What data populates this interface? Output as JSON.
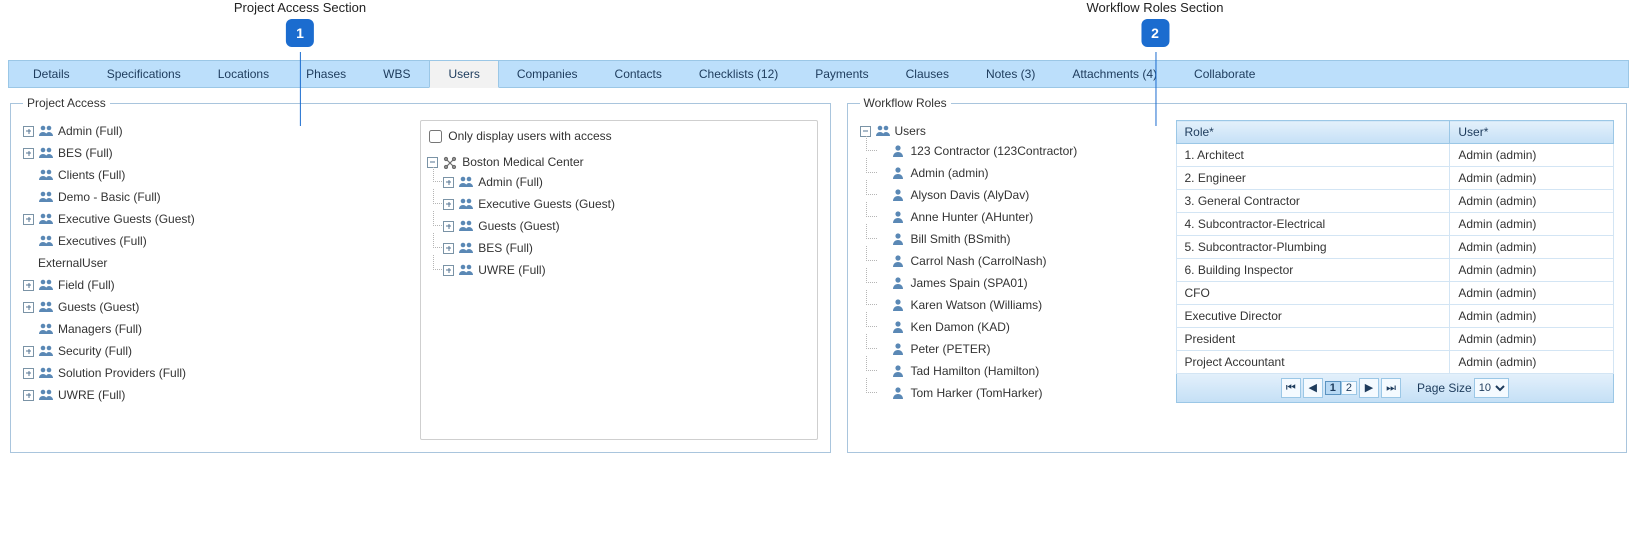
{
  "annotations": {
    "left": {
      "label": "Project Access Section",
      "badge": "1"
    },
    "right": {
      "label": "Workflow Roles Section",
      "badge": "2"
    }
  },
  "tabs": [
    {
      "label": "Details"
    },
    {
      "label": "Specifications"
    },
    {
      "label": "Locations"
    },
    {
      "label": "Phases"
    },
    {
      "label": "WBS"
    },
    {
      "label": "Users",
      "active": true
    },
    {
      "label": "Companies"
    },
    {
      "label": "Contacts"
    },
    {
      "label": "Checklists (12)"
    },
    {
      "label": "Payments"
    },
    {
      "label": "Clauses"
    },
    {
      "label": "Notes (3)"
    },
    {
      "label": "Attachments (4)"
    },
    {
      "label": "Collaborate"
    }
  ],
  "project_access": {
    "legend": "Project Access",
    "only_display_label": "Only display users with access",
    "only_display_checked": false,
    "groups": [
      {
        "label": "Admin (Full)",
        "toggle": "plus",
        "icon": "users"
      },
      {
        "label": "BES (Full)",
        "toggle": "plus",
        "icon": "users"
      },
      {
        "label": "Clients (Full)",
        "toggle": "none",
        "icon": "users"
      },
      {
        "label": "Demo - Basic (Full)",
        "toggle": "none",
        "icon": "users"
      },
      {
        "label": "Executive Guests (Guest)",
        "toggle": "plus",
        "icon": "users"
      },
      {
        "label": "Executives (Full)",
        "toggle": "none",
        "icon": "users"
      },
      {
        "label": "ExternalUser",
        "toggle": "none",
        "icon": "none"
      },
      {
        "label": "Field (Full)",
        "toggle": "plus",
        "icon": "users"
      },
      {
        "label": "Guests (Guest)",
        "toggle": "plus",
        "icon": "users"
      },
      {
        "label": "Managers (Full)",
        "toggle": "none",
        "icon": "users"
      },
      {
        "label": "Security (Full)",
        "toggle": "plus",
        "icon": "users"
      },
      {
        "label": "Solution Providers (Full)",
        "toggle": "plus",
        "icon": "users"
      },
      {
        "label": "UWRE (Full)",
        "toggle": "plus",
        "icon": "users"
      }
    ],
    "org": {
      "label": "Boston Medical Center",
      "toggle": "minus",
      "children": [
        {
          "label": "Admin (Full)",
          "toggle": "plus"
        },
        {
          "label": "Executive Guests (Guest)",
          "toggle": "plus"
        },
        {
          "label": "Guests (Guest)",
          "toggle": "plus"
        },
        {
          "label": "BES (Full)",
          "toggle": "plus"
        },
        {
          "label": "UWRE (Full)",
          "toggle": "plus"
        }
      ]
    }
  },
  "workflow": {
    "legend": "Workflow Roles",
    "users_root": "Users",
    "users": [
      "123 Contractor (123Contractor)",
      "Admin (admin)",
      "Alyson Davis (AlyDav)",
      "Anne Hunter (AHunter)",
      "Bill Smith (BSmith)",
      "Carrol Nash (CarrolNash)",
      "James Spain (SPA01)",
      "Karen Watson (Williams)",
      "Ken Damon (KAD)",
      "Peter (PETER)",
      "Tad Hamilton (Hamilton)",
      "Tom Harker (TomHarker)"
    ],
    "table": {
      "headers": {
        "role": "Role*",
        "user": "User*"
      },
      "rows": [
        {
          "role": "1. Architect",
          "user": "Admin (admin)"
        },
        {
          "role": "2. Engineer",
          "user": "Admin (admin)"
        },
        {
          "role": "3. General Contractor",
          "user": "Admin (admin)"
        },
        {
          "role": "4. Subcontractor-Electrical",
          "user": "Admin (admin)"
        },
        {
          "role": "5. Subcontractor-Plumbing",
          "user": "Admin (admin)"
        },
        {
          "role": "6. Building Inspector",
          "user": "Admin (admin)"
        },
        {
          "role": "CFO",
          "user": "Admin (admin)"
        },
        {
          "role": "Executive Director",
          "user": "Admin (admin)"
        },
        {
          "role": "President",
          "user": "Admin (admin)"
        },
        {
          "role": "Project Accountant",
          "user": "Admin (admin)"
        }
      ]
    },
    "pager": {
      "pages": [
        "1",
        "2"
      ],
      "current": "1",
      "page_size_label": "Page Size",
      "page_size_value": "10"
    }
  }
}
